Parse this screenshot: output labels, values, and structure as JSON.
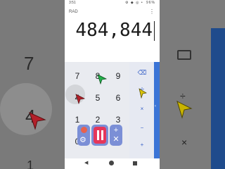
{
  "statusbar": {
    "time": "3:51",
    "icons": "⚙ ◆ ◎ •",
    "battery": "96%"
  },
  "display": {
    "mode": "RAD",
    "more_icon": "⋮",
    "result": "484,844"
  },
  "keypad": {
    "keys": [
      "7",
      "8",
      "9",
      "4",
      "5",
      "6",
      "1",
      "2",
      "3",
      "0"
    ]
  },
  "operators": {
    "backspace": "⌫",
    "divide": "÷",
    "multiply": "×",
    "minus": "−",
    "plus": "+"
  },
  "side_panel": {
    "chevron": "‹"
  },
  "controls": {
    "gear_icon": "⚙",
    "plus_icon": "+",
    "close_icon": "✕"
  },
  "navbar": {
    "back": "◀"
  },
  "background": {
    "digits": [
      "7",
      "4",
      "1"
    ]
  },
  "colors": {
    "accent": "#3b74d6",
    "pause": "#e5365a",
    "control": "#7b8fd6",
    "record": "#e8614d"
  }
}
